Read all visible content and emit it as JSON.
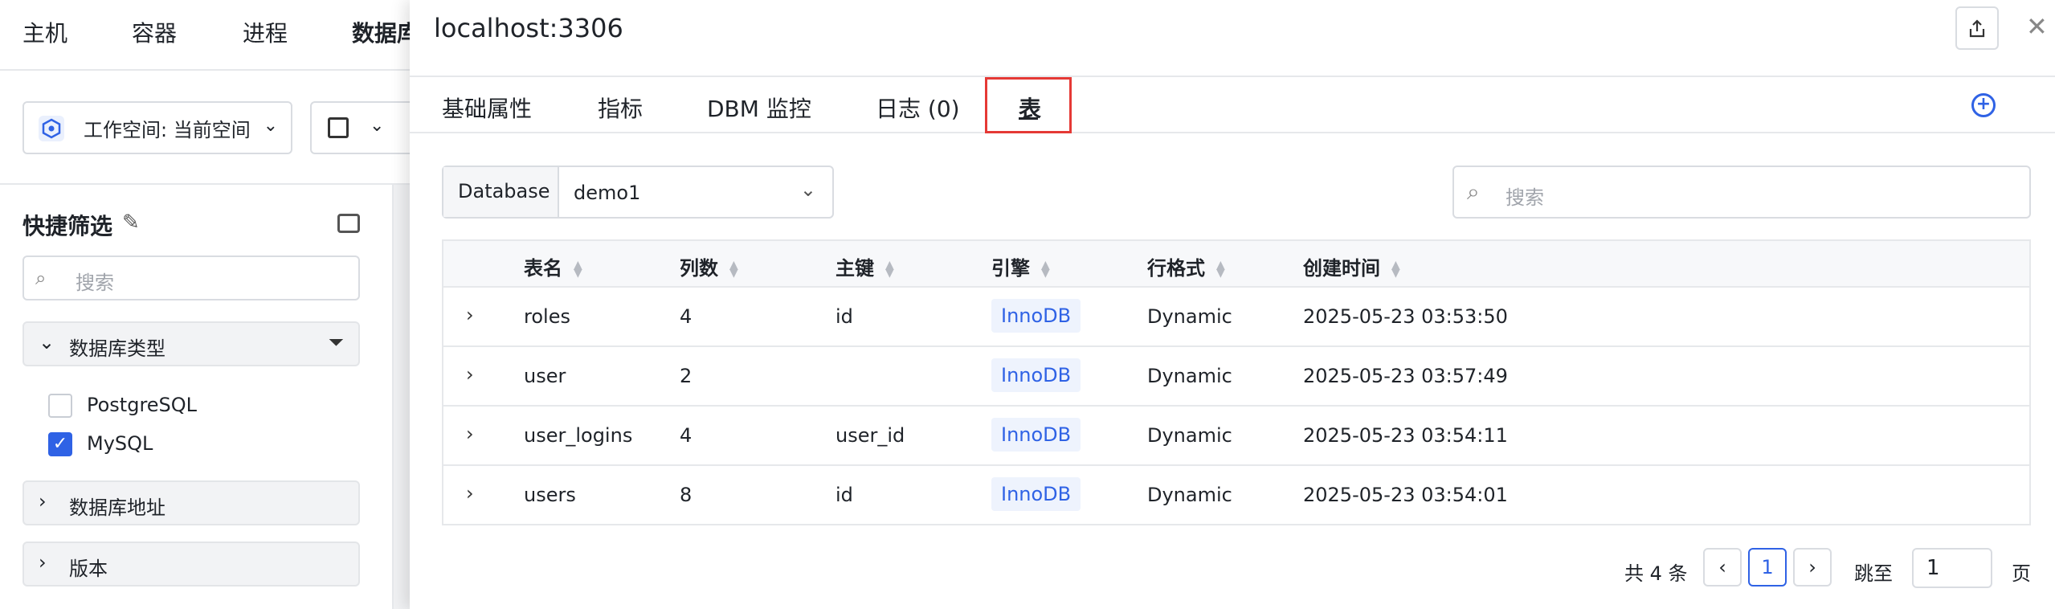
{
  "background": {
    "nav": [
      "主机",
      "容器",
      "进程",
      "数据库"
    ],
    "workspace_label": "工作空间: 当前空间",
    "quick_filter": {
      "title": "快捷筛选",
      "search_placeholder": "搜索",
      "groups": [
        {
          "label": "数据库类型",
          "expanded": true
        },
        {
          "label": "数据库地址",
          "expanded": false
        },
        {
          "label": "版本",
          "expanded": false
        }
      ],
      "db_type_options": [
        {
          "label": "PostgreSQL",
          "checked": false
        },
        {
          "label": "MySQL",
          "checked": true
        }
      ]
    }
  },
  "drawer": {
    "title": "localhost:3306",
    "tabs": [
      "基础属性",
      "指标",
      "DBM 监控",
      "日志 (0)",
      "表"
    ],
    "active_tab": "表",
    "database_select": {
      "prefix": "Database",
      "value": "demo1"
    },
    "search_placeholder": "搜索",
    "table": {
      "columns": [
        "表名",
        "列数",
        "主键",
        "引擎",
        "行格式",
        "创建时间"
      ],
      "rows": [
        {
          "name": "roles",
          "columns": "4",
          "pk": "id",
          "engine": "InnoDB",
          "row_format": "Dynamic",
          "created": "2025-05-23 03:53:50"
        },
        {
          "name": "user",
          "columns": "2",
          "pk": "",
          "engine": "InnoDB",
          "row_format": "Dynamic",
          "created": "2025-05-23 03:57:49"
        },
        {
          "name": "user_logins",
          "columns": "4",
          "pk": "user_id",
          "engine": "InnoDB",
          "row_format": "Dynamic",
          "created": "2025-05-23 03:54:11"
        },
        {
          "name": "users",
          "columns": "8",
          "pk": "id",
          "engine": "InnoDB",
          "row_format": "Dynamic",
          "created": "2025-05-23 03:54:01"
        }
      ]
    },
    "pagination": {
      "total": "共 4 条",
      "current_page": "1",
      "jump_label": "跳至",
      "jump_value": "1",
      "jump_suffix": "页"
    }
  },
  "colors": {
    "accent": "#2f62e5",
    "highlight": "#e53935"
  }
}
